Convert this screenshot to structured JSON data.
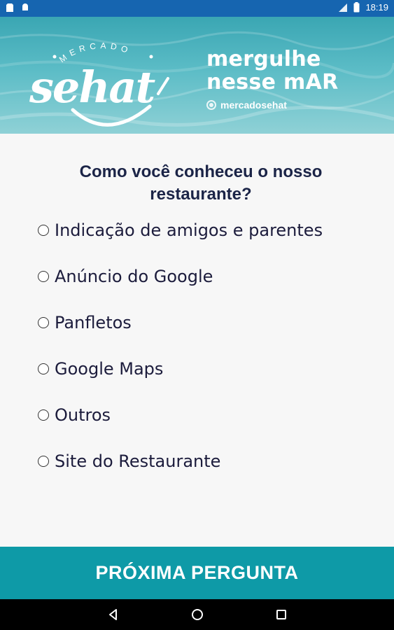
{
  "status_bar": {
    "time": "18:19",
    "left_icons": [
      "storage-icon",
      "android-icon"
    ],
    "right_icons": [
      "signal-icon",
      "battery-icon"
    ],
    "background": "#1665b0"
  },
  "banner": {
    "logo_top_text": "MERCADO",
    "logo_script_text": "sehat",
    "slogan_line1": "mergulhe",
    "slogan_line2": "nesse mAR",
    "handle_icon": "instagram-icon",
    "handle": "mercadosehat"
  },
  "survey": {
    "question": "Como você conheceu o nosso restaurante?",
    "options": [
      {
        "label": "Indicação de amigos e parentes",
        "selected": false
      },
      {
        "label": "Anúncio do Google",
        "selected": false
      },
      {
        "label": "Panfletos",
        "selected": false
      },
      {
        "label": "Google Maps",
        "selected": false
      },
      {
        "label": "Outros",
        "selected": false
      },
      {
        "label": "Site do Restaurante",
        "selected": false
      }
    ]
  },
  "next_button": {
    "label": "PRÓXIMA PERGUNTA",
    "color": "#0e9aa7"
  },
  "nav_bar": {
    "icons": [
      "back-icon",
      "home-icon",
      "recents-icon"
    ]
  },
  "colors": {
    "question_text": "#1b2447",
    "banner_sea": "#4fb3bf"
  }
}
